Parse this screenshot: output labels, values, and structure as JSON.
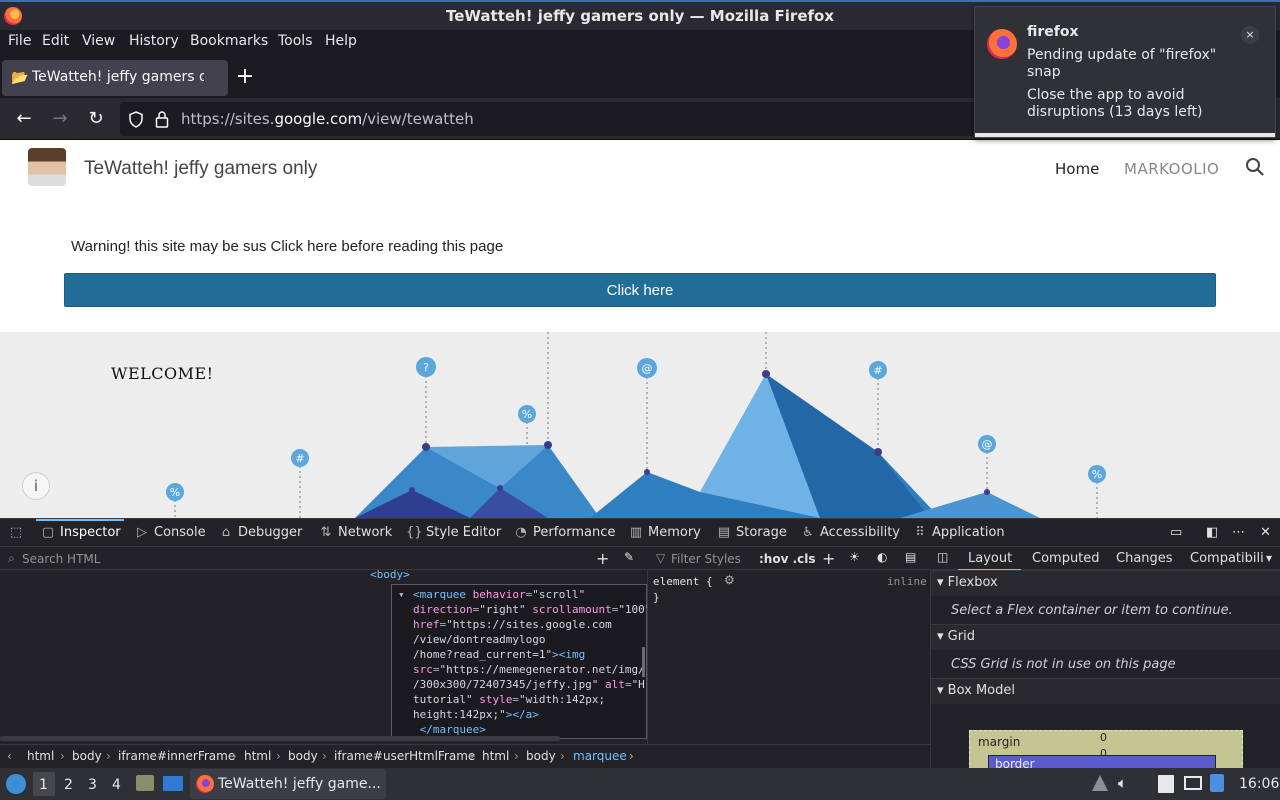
{
  "window": {
    "title": "TeWatteh! jeffy gamers only — Mozilla Firefox"
  },
  "menubar": [
    "File",
    "Edit",
    "View",
    "History",
    "Bookmarks",
    "Tools",
    "Help"
  ],
  "tab": {
    "title": "TeWatteh! jeffy gamers only",
    "new_tab": "+"
  },
  "navbar": {
    "back": "←",
    "forward": "→",
    "reload": "↻",
    "url_prefix": "https://sites.",
    "url_domain": "google.com",
    "url_path": "/view/tewatteh"
  },
  "notification": {
    "app": "firefox",
    "line1": "Pending update of \"firefox\" snap",
    "line2": "Close the app to avoid disruptions (13 days left)",
    "close": "×"
  },
  "site": {
    "title": "TeWatteh! jeffy gamers only",
    "nav": {
      "home": "Home",
      "markoolio": "MARKOOLIO"
    },
    "warning": "Warning! this site may be sus Click here before reading this page",
    "button": "Click here",
    "welcome": "WELCOME!",
    "info": "i"
  },
  "devtools": {
    "tabs": [
      "Inspector",
      "Console",
      "Debugger",
      "Network",
      "Style Editor",
      "Performance",
      "Memory",
      "Storage",
      "Accessibility",
      "Application"
    ],
    "search_placeholder": "Search HTML",
    "filter_placeholder": "Filter Styles",
    "pseudo": ":hov .cls",
    "body_tag": "<body>",
    "element_rule": "element {",
    "element_close": "}",
    "inline": "inline",
    "side_tabs": [
      "Layout",
      "Computed",
      "Changes",
      "Compatibili"
    ],
    "flexbox": {
      "header": "Flexbox",
      "msg": "Select a Flex container or item to continue."
    },
    "grid": {
      "header": "Grid",
      "msg": "CSS Grid is not in use on this page"
    },
    "boxmodel": {
      "header": "Box Model",
      "margin": "margin",
      "border": "border",
      "zero": "0"
    },
    "breadcrumbs": [
      "html",
      "body",
      "iframe#innerFrame",
      "html",
      "body",
      "iframe#userHtmlFrame",
      "html",
      "body",
      "marquee"
    ]
  },
  "code": {
    "l1_tag": "<marquee",
    "l1_attr": " behavior",
    "l1_val": "\"scroll\"",
    "l2_attr": "direction",
    "l2_val": "\"right\"",
    "l2_attr2": " scrollamount",
    "l2_val2": "\"100\"",
    "l3_attr": "href",
    "l3_val": "\"https://sites.google.com",
    "l4_val": "/view/dontreadmylogo",
    "l5_val": "/home?read_current=1\"",
    "l5_tag": "><img",
    "l6_attr": "src",
    "l6_val": "\"https://memegenerator.net/img/",
    "l7_val": "/300x300/72407345/jeffy.jpg\"",
    "l7_attr": " alt",
    "l7_val2": "\"H",
    "l8_val": "tutorial\"",
    "l8_attr": " style",
    "l8_val2": "\"width:142px;",
    "l9_val": "height:142px;\"",
    "l9_tag": "></a>",
    "l10_tag": "</marquee>"
  },
  "taskbar": {
    "workspaces": [
      "1",
      "2",
      "3",
      "4"
    ],
    "app_label": "TeWatteh! jeffy game...",
    "clock": "16:06"
  }
}
